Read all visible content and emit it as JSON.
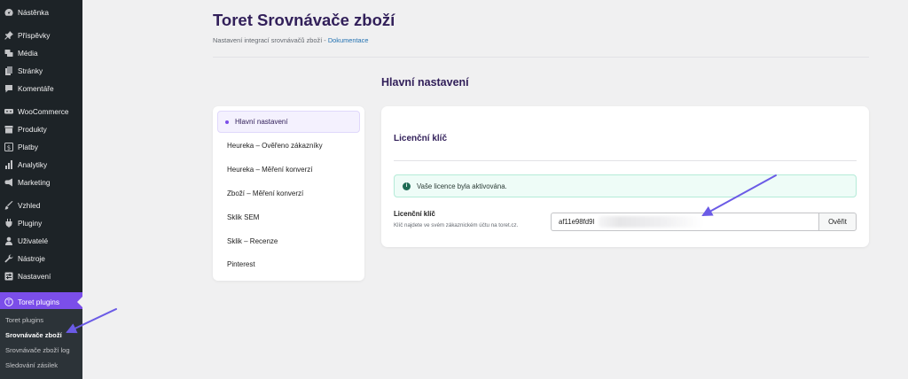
{
  "sidebar": {
    "items": [
      {
        "label": "Nástěnka",
        "icon": "dashboard-icon"
      },
      {
        "label": "Příspěvky",
        "icon": "pin-icon"
      },
      {
        "label": "Média",
        "icon": "media-icon"
      },
      {
        "label": "Stránky",
        "icon": "page-icon"
      },
      {
        "label": "Komentáře",
        "icon": "comment-icon"
      },
      {
        "label": "WooCommerce",
        "icon": "woo-icon"
      },
      {
        "label": "Produkty",
        "icon": "archive-icon"
      },
      {
        "label": "Platby",
        "icon": "dollar-icon"
      },
      {
        "label": "Analytiky",
        "icon": "chart-icon"
      },
      {
        "label": "Marketing",
        "icon": "megaphone-icon"
      },
      {
        "label": "Vzhled",
        "icon": "brush-icon"
      },
      {
        "label": "Pluginy",
        "icon": "plug-icon"
      },
      {
        "label": "Uživatelé",
        "icon": "user-icon"
      },
      {
        "label": "Nástroje",
        "icon": "wrench-icon"
      },
      {
        "label": "Nastavení",
        "icon": "settings-icon"
      },
      {
        "label": "Toret plugins",
        "icon": "toret-icon"
      }
    ],
    "submenu": [
      {
        "label": "Toret plugins"
      },
      {
        "label": "Srovnávače zboží"
      },
      {
        "label": "Srovnávače zboží log"
      },
      {
        "label": "Sledování zásilek"
      }
    ]
  },
  "header": {
    "title": "Toret Srovnávače zboží",
    "subtitle": "Nastavení integrací srovnávačů zboží",
    "separator": " - ",
    "doc_link": "Dokumentace"
  },
  "section_heading": "Hlavní nastavení",
  "nav": {
    "items": [
      {
        "label": "Hlavní nastavení"
      },
      {
        "label": "Heureka – Ověřeno zákazníky"
      },
      {
        "label": "Heureka – Měření konverzí"
      },
      {
        "label": "Zboží – Měření konverzí"
      },
      {
        "label": "Sklik SEM"
      },
      {
        "label": "Sklik – Recenze"
      },
      {
        "label": "Pinterest"
      }
    ]
  },
  "card": {
    "title": "Licenční klíč",
    "notice": "Vaše licence byla aktivována.",
    "field_label": "Licenční klíč",
    "field_help": "Klíč najdete ve svém zákaznickém účtu na toret.cz.",
    "license_value": "af11e98fd9l",
    "verify_label": "Ověřit"
  },
  "colors": {
    "accent": "#7b4ee9",
    "title": "#32205a",
    "sidebar_bg": "#1d2327",
    "notice_bg": "#eefcf7"
  }
}
